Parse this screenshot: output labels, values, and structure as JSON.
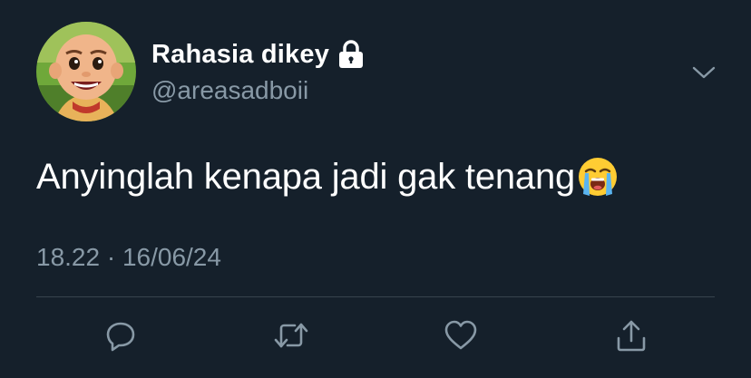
{
  "tweet": {
    "display_name": "Rahasia dikey",
    "handle": "@areasadboii",
    "text": "Anyinglah kenapa jadi gak tenang",
    "emoji": "loudly-crying-face",
    "timestamp": "18.22 · 16/06/24",
    "protected_icon": "lock-icon",
    "menu_icon": "chevron-down-icon"
  },
  "actions": [
    {
      "name": "reply",
      "icon": "reply-icon"
    },
    {
      "name": "retweet",
      "icon": "retweet-icon"
    },
    {
      "name": "like",
      "icon": "heart-icon"
    },
    {
      "name": "share",
      "icon": "share-icon"
    }
  ],
  "colors": {
    "background": "#15202b",
    "primary_text": "#ffffff",
    "secondary_text": "#8899a6",
    "divider": "#38444d"
  }
}
